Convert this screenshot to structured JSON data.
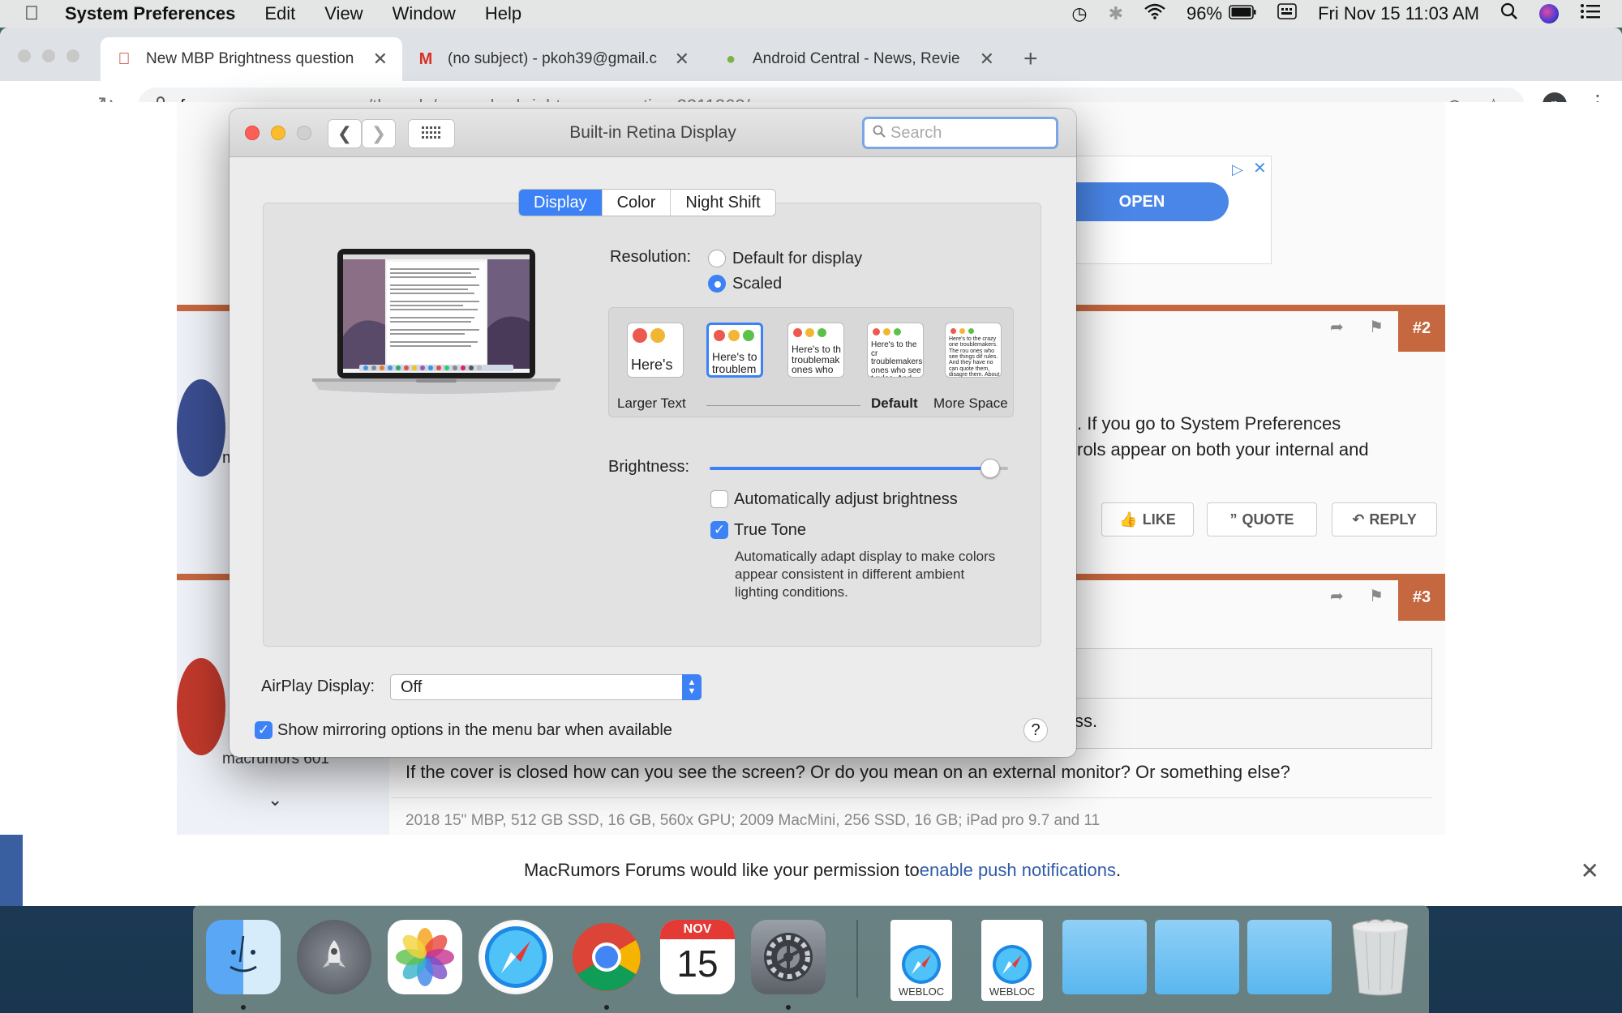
{
  "menubar": {
    "app_name": "System Preferences",
    "items": [
      "Edit",
      "View",
      "Window",
      "Help"
    ],
    "battery": "96%",
    "datetime": "Fri Nov 15  11:03 AM"
  },
  "browser": {
    "tabs": [
      {
        "label": "New MBP Brightness question",
        "icon": "macrumors-icon"
      },
      {
        "label": "(no subject) - pkoh39@gmail.c",
        "icon": "gmail-icon"
      },
      {
        "label": "Android Central - News, Revie",
        "icon": "android-central-icon"
      }
    ],
    "url_host": "forums.macrumors.com",
    "url_path": "/threads/new-mbp-brightness-question.2211362/",
    "profile_initial": "p"
  },
  "forum": {
    "ad_button": "OPEN",
    "post2": {
      "number": "#2",
      "text_line1": ". If you go to System Preferences",
      "text_line2": "rols appear on both your internal and",
      "user_partial": "m",
      "like": "LIKE",
      "quote": "QUOTE",
      "reply": "REPLY"
    },
    "post3": {
      "number": "#3",
      "quote_partial": "ss.",
      "user_title": "macrumors 601",
      "body": "If the cover is closed how can you see the screen? Or do you mean on an external monitor? Or something else?",
      "signature": "2018 15\" MBP, 512 GB SSD, 16 GB, 560x GPU; 2009 MacMini, 256 SSD, 16 GB; iPad pro 9.7 and 11"
    },
    "push": {
      "prefix": "MacRumors Forums would like your permission to ",
      "link": "enable push notifications",
      "suffix": "."
    }
  },
  "prefs": {
    "title": "Built-in Retina Display",
    "search_placeholder": "Search",
    "tabs": [
      "Display",
      "Color",
      "Night Shift"
    ],
    "resolution_label": "Resolution:",
    "resolution_options": [
      "Default for display",
      "Scaled"
    ],
    "resolution_selected": "Scaled",
    "scale_thumbs": [
      "Here's",
      "Here's to troublem",
      "Here's to th troublemak ones who",
      "Here's to the cr troublemakers. ones who see t rules. And they",
      "Here's to the crazy one troublemakers. The rou ones who see things dif rules. And they have no can quote them, disagre them. About the only th Because they change"
    ],
    "scale_labels": {
      "left": "Larger Text",
      "default": "Default",
      "right": "More Space"
    },
    "brightness_label": "Brightness:",
    "brightness_level": 0.97,
    "auto_brightness": {
      "label": "Automatically adjust brightness",
      "checked": false
    },
    "true_tone": {
      "label": "True Tone",
      "checked": true,
      "description_lines": [
        "Automatically adapt display to make colors",
        "appear consistent in different ambient",
        "lighting conditions."
      ]
    },
    "airplay_label": "AirPlay Display:",
    "airplay_value": "Off",
    "mirroring": {
      "label": "Show mirroring options in the menu bar when available",
      "checked": true
    },
    "help": "?"
  },
  "dock": {
    "items": [
      "Finder",
      "Launchpad",
      "Photos",
      "Safari",
      "Chrome",
      "Calendar",
      "System Preferences",
      "WEBLOC",
      "WEBLOC",
      "Folder",
      "Folder",
      "Folder",
      "Trash"
    ],
    "calendar_month": "NOV",
    "calendar_day": "15",
    "webloc_label": "WEBLOC"
  },
  "colors": {
    "accent": "#3c82f6",
    "forum_orange": "#c5673f",
    "chrome_tabstrip": "#dee1e6"
  }
}
